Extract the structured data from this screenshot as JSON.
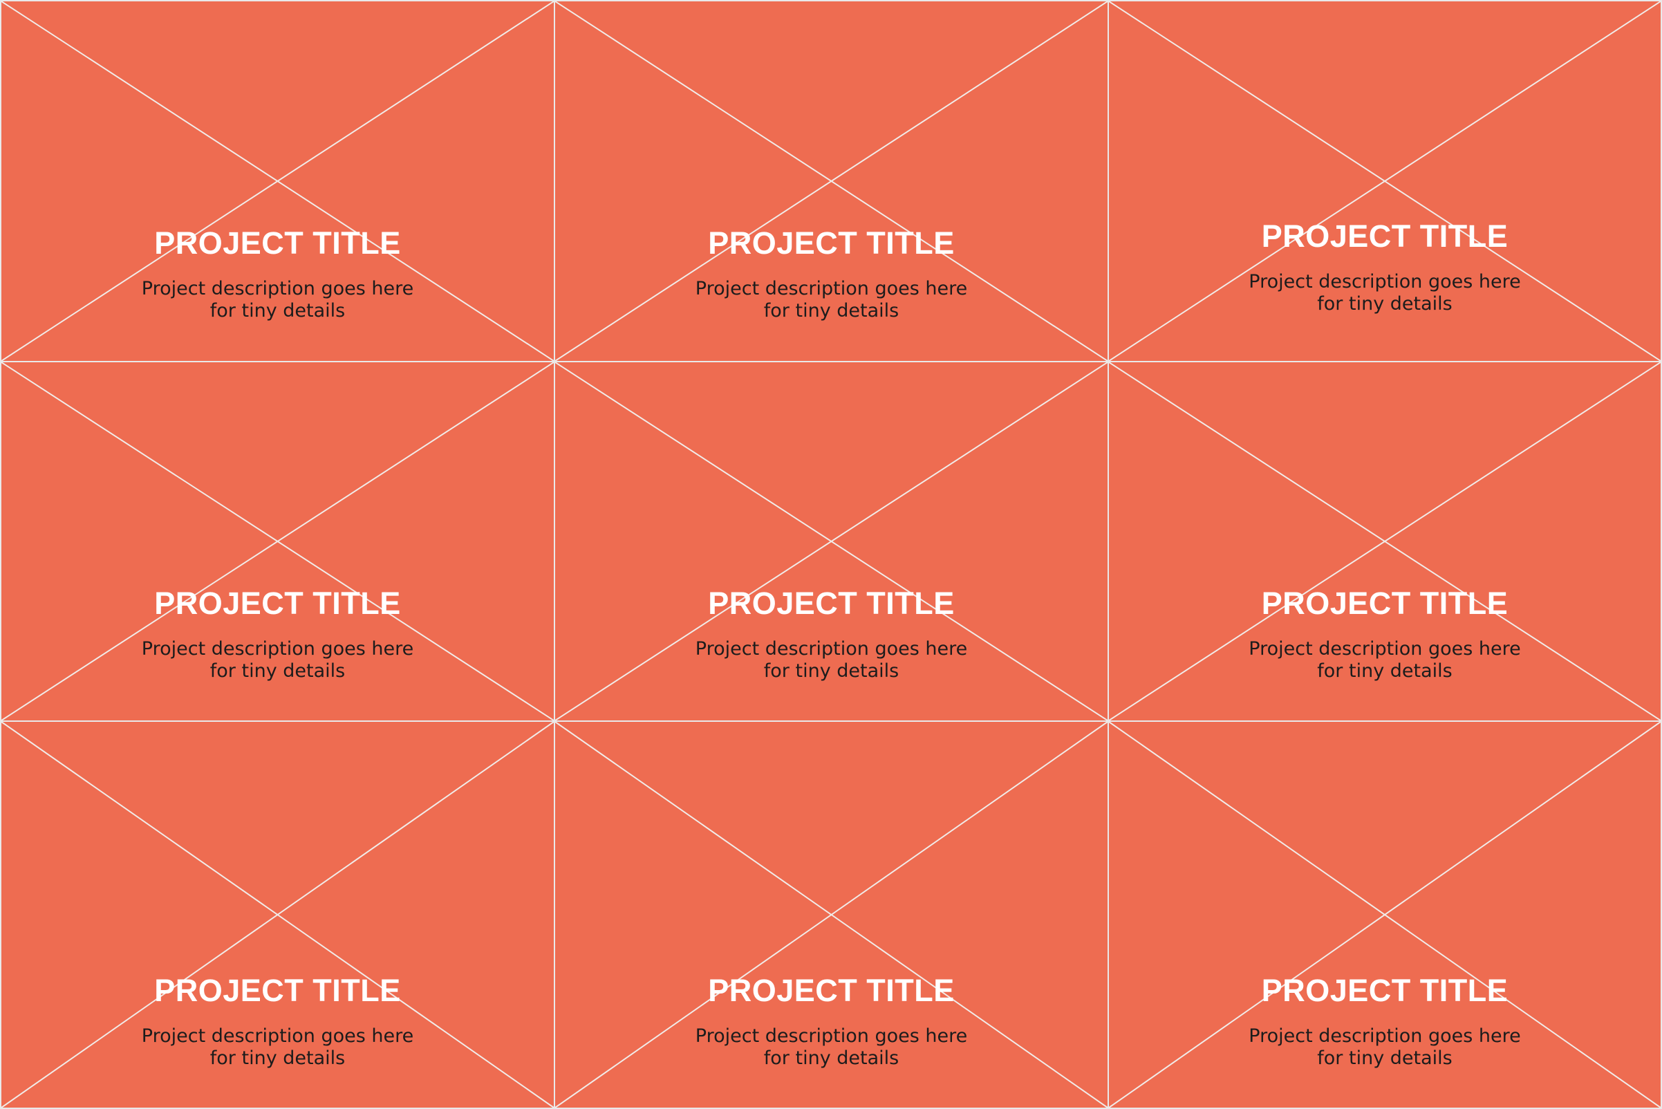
{
  "tile_color": "#ee6c51",
  "placeholder_icon": "image-placeholder-cross-icon",
  "tiles": [
    {
      "title": "PROJECT TITLE",
      "description": "Project description goes here for tiny details"
    },
    {
      "title": "PROJECT TITLE",
      "description": "Project description goes here for tiny details"
    },
    {
      "title": "PROJECT TITLE",
      "description": "Project description goes here for tiny details"
    },
    {
      "title": "PROJECT TITLE",
      "description": "Project description goes here for tiny details"
    },
    {
      "title": "PROJECT TITLE",
      "description": "Project description goes here for tiny details"
    },
    {
      "title": "PROJECT TITLE",
      "description": "Project description goes here for tiny details"
    },
    {
      "title": "PROJECT TITLE",
      "description": "Project description goes here for tiny details"
    },
    {
      "title": "PROJECT TITLE",
      "description": "Project description goes here for tiny details"
    },
    {
      "title": "PROJECT TITLE",
      "description": "Project description goes here for tiny details"
    }
  ]
}
